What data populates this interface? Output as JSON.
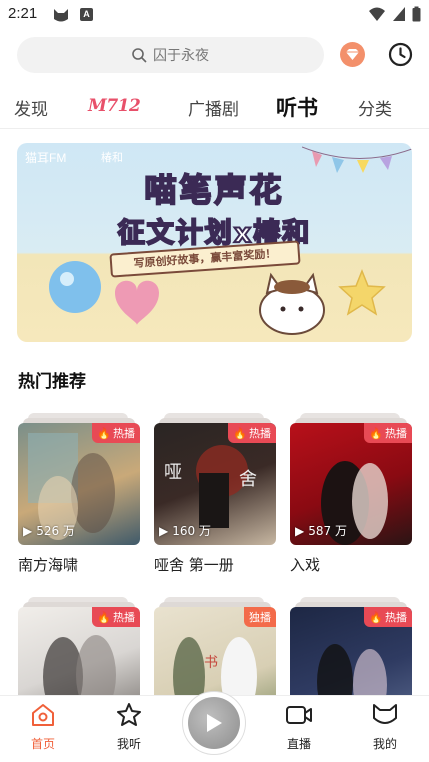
{
  "status_bar": {
    "time": "2:21",
    "a_icon": "A"
  },
  "search": {
    "placeholder": "囚于永夜"
  },
  "tabs": [
    {
      "label": "发现"
    },
    {
      "label": "M712"
    },
    {
      "label": "广播剧"
    },
    {
      "label": "听书"
    },
    {
      "label": "分类"
    }
  ],
  "banner": {
    "brand": "猫耳FM",
    "partner": "椿和",
    "title_line1": "喵笔声花",
    "title_line2": "征文计划x椿和",
    "ribbon": "写原创好故事，赢丰富奖励！"
  },
  "section": {
    "title": "热门推荐"
  },
  "cards": [
    {
      "name": "南方海啸",
      "plays": "526 万",
      "badge": "热播",
      "colors": [
        "#7a8f8a",
        "#c9a979",
        "#3f5a6a"
      ]
    },
    {
      "name": "哑舍 第一册",
      "plays": "160 万",
      "badge": "热播",
      "colors": [
        "#2a2523",
        "#8c2a22",
        "#c7b7a2"
      ]
    },
    {
      "name": "入戏",
      "plays": "587 万",
      "badge": "热播",
      "colors": [
        "#b8101a",
        "#2a1414",
        "#e6d6d0"
      ]
    },
    {
      "name": "",
      "plays": "",
      "badge": "热播",
      "colors": [
        "#d9d6d3",
        "#6f6a66",
        "#f1eeea"
      ]
    },
    {
      "name": "",
      "plays": "",
      "badge": "独播",
      "colors": [
        "#e9e2cf",
        "#7c8a5f",
        "#c54a3f"
      ]
    },
    {
      "name": "",
      "plays": "",
      "badge": "热播",
      "colors": [
        "#1d2744",
        "#5b6a8f",
        "#c9b9c9"
      ]
    }
  ],
  "bottom_nav": [
    {
      "label": "首页",
      "icon": "home-icon",
      "active": true
    },
    {
      "label": "我听",
      "icon": "star-icon",
      "active": false
    },
    {
      "label": "",
      "icon": "play-icon",
      "active": false
    },
    {
      "label": "直播",
      "icon": "camera-icon",
      "active": false
    },
    {
      "label": "我的",
      "icon": "cat-face-icon",
      "active": false
    }
  ],
  "colors": {
    "accent": "#f0603a",
    "hot_badge": "#e84a55",
    "gem": "#f3906b"
  }
}
